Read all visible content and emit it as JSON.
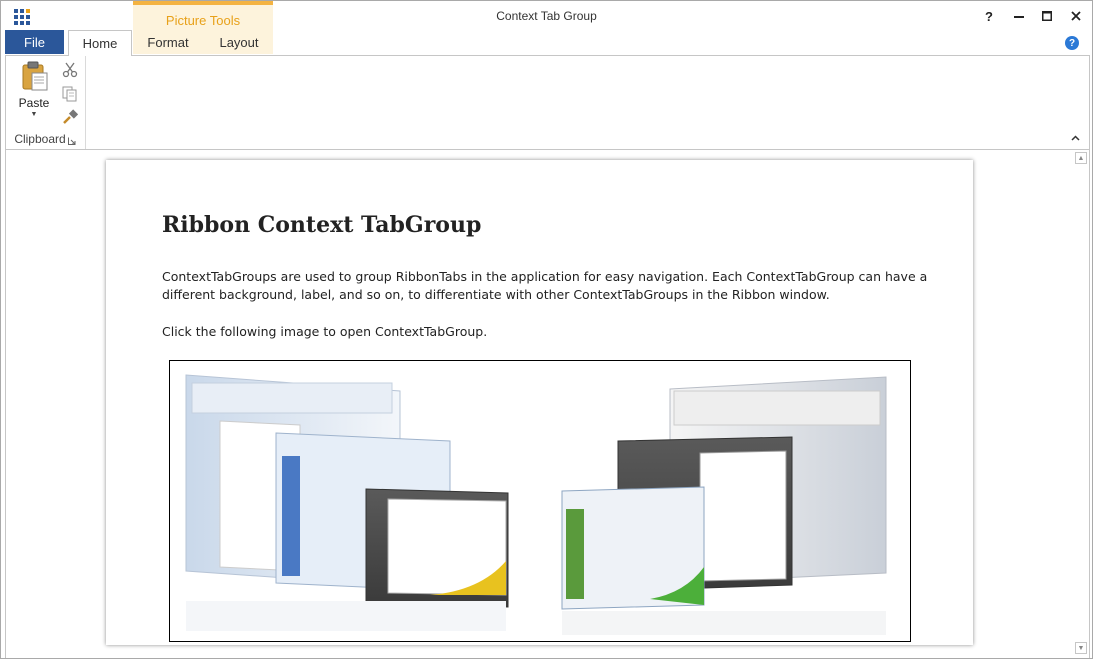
{
  "window": {
    "title": "Context Tab Group",
    "help_label": "?",
    "minimize_label": "—",
    "maximize_label": "☐",
    "close_label": "✕"
  },
  "context_group": {
    "label": "Picture Tools",
    "color": "#f4b342"
  },
  "tabs": {
    "file": "File",
    "home": "Home",
    "format": "Format",
    "layout": "Layout"
  },
  "ribbon": {
    "clipboard_group_label": "Clipboard",
    "paste_label": "Paste",
    "help_icon": "?"
  },
  "document": {
    "title": "Ribbon Context TabGroup",
    "paragraph": "ContextTabGroups are used to group RibbonTabs in the application for easy navigation. Each ContextTabGroup can have a different background, label, and so on, to differentiate with other ContextTabGroups in the Ribbon window.",
    "instruction": "Click the following image to open ContextTabGroup."
  },
  "colors": {
    "file_tab": "#2b579a",
    "context_accent": "#f4b342",
    "context_background": "#fdf3dc"
  }
}
